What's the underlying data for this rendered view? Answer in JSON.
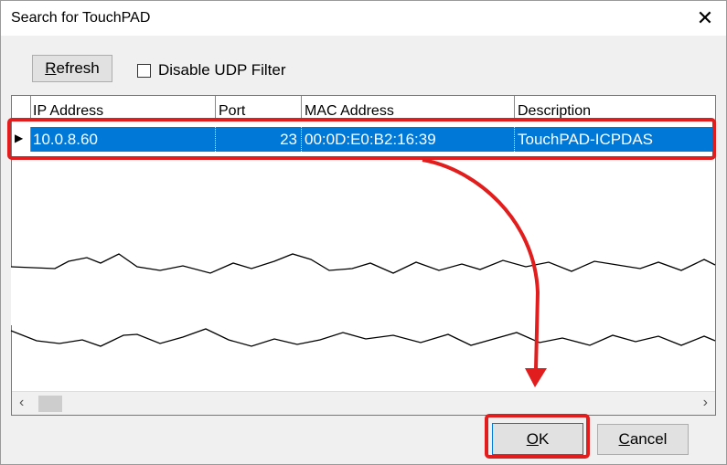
{
  "window": {
    "title": "Search for TouchPAD",
    "close_glyph": "✕"
  },
  "toolbar": {
    "refresh_label": "Refresh",
    "refresh_underline": "R",
    "refresh_rest": "efresh",
    "disable_udp_label": "Disable UDP Filter",
    "disable_udp_checked": false
  },
  "grid": {
    "columns": [
      "IP Address",
      "Port",
      "MAC Address",
      "Description"
    ],
    "rows": [
      {
        "ip": "10.0.8.60",
        "port": "23",
        "mac": "00:0D:E0:B2:16:39",
        "description": "TouchPAD-ICPDAS",
        "selected": true
      }
    ],
    "row_indicator": "▶"
  },
  "scrollbar": {
    "left_arrow": "‹",
    "right_arrow": "›"
  },
  "buttons": {
    "ok_underline": "O",
    "ok_rest": "K",
    "cancel_underline": "C",
    "cancel_rest": "ancel"
  },
  "annotation": {
    "highlight_color": "#e21d1d",
    "selection_color": "#0078d7"
  }
}
